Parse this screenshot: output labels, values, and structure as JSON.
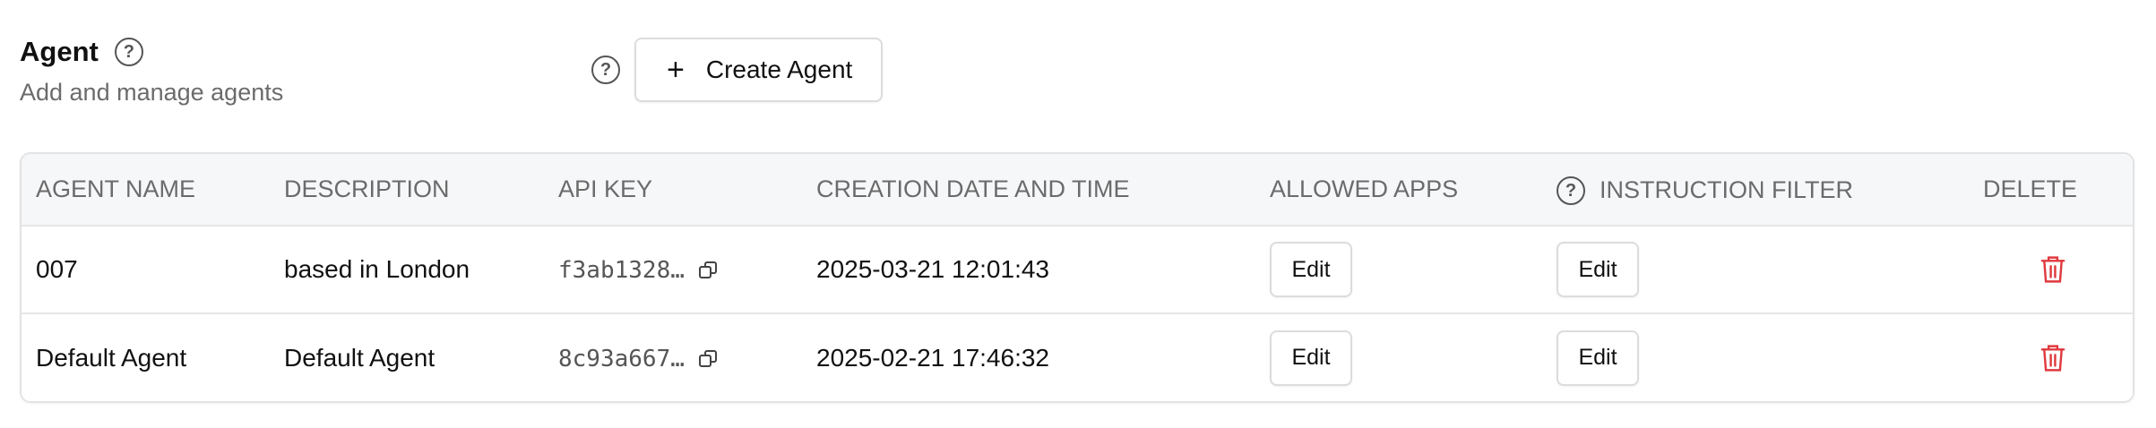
{
  "header": {
    "title": "Agent",
    "subtitle": "Add and manage agents",
    "create_button_label": "Create Agent",
    "help_glyph": "?"
  },
  "table": {
    "columns": [
      "AGENT NAME",
      "DESCRIPTION",
      "API KEY",
      "CREATION DATE AND TIME",
      "ALLOWED APPS",
      "INSTRUCTION FILTER",
      "DELETE"
    ],
    "rows": [
      {
        "name": "007",
        "description": "based in London",
        "api_key": "f3ab1328…",
        "created": "2025-03-21 12:01:43",
        "allowed_apps_label": "Edit",
        "instruction_filter_label": "Edit"
      },
      {
        "name": "Default Agent",
        "description": "Default Agent",
        "api_key": "8c93a667…",
        "created": "2025-02-21 17:46:32",
        "allowed_apps_label": "Edit",
        "instruction_filter_label": "Edit"
      }
    ]
  },
  "icons": {
    "help": "question-circle-icon",
    "plus": "plus-icon",
    "copy": "copy-icon",
    "delete": "trash-icon"
  },
  "colors": {
    "delete": "#e0393e",
    "header_bg": "#f6f7f9",
    "muted_text": "#6b6b6b"
  }
}
